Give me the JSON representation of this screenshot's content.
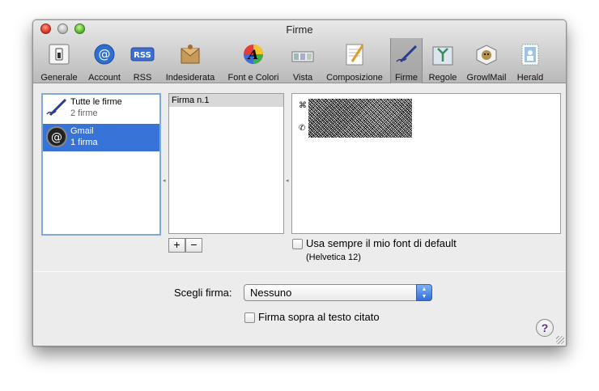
{
  "window": {
    "title": "Firme"
  },
  "toolbar": {
    "items": [
      {
        "label": "Generale",
        "icon": "switch-icon"
      },
      {
        "label": "Account",
        "icon": "at-sign-icon"
      },
      {
        "label": "RSS",
        "icon": "rss-icon"
      },
      {
        "label": "Indesiderata",
        "icon": "junk-mail-icon"
      },
      {
        "label": "Font e Colori",
        "icon": "font-colors-icon"
      },
      {
        "label": "Vista",
        "icon": "view-icon"
      },
      {
        "label": "Composizione",
        "icon": "compose-icon"
      },
      {
        "label": "Firme",
        "icon": "signature-pen-icon"
      },
      {
        "label": "Regole",
        "icon": "rules-icon"
      },
      {
        "label": "GrowlMail",
        "icon": "growl-icon"
      },
      {
        "label": "Herald",
        "icon": "herald-stamp-icon"
      }
    ],
    "selected": "Firme",
    "rss_glyph": "RSS",
    "font_glyph": "A"
  },
  "accounts": [
    {
      "name": "Tutte le firme",
      "count": "2 firme",
      "selected": false
    },
    {
      "name": "Gmail",
      "count": "1 firma",
      "selected": true
    }
  ],
  "signatures": {
    "items": [
      "Firma n.1"
    ]
  },
  "editor": {
    "symbols": [
      "⌘",
      "",
      "✆"
    ]
  },
  "buttons": {
    "add": "+",
    "remove": "−",
    "help": "?"
  },
  "default_font": {
    "label": "Usa sempre il mio font di default",
    "font": "(Helvetica 12)",
    "checked": false
  },
  "choose": {
    "label": "Scegli firma:",
    "value": "Nessuno"
  },
  "above_quote": {
    "label": "Firma sopra al testo citato",
    "checked": false
  },
  "colors": {
    "selection": "#3874d8",
    "focus_ring": "#7ea9d8"
  }
}
